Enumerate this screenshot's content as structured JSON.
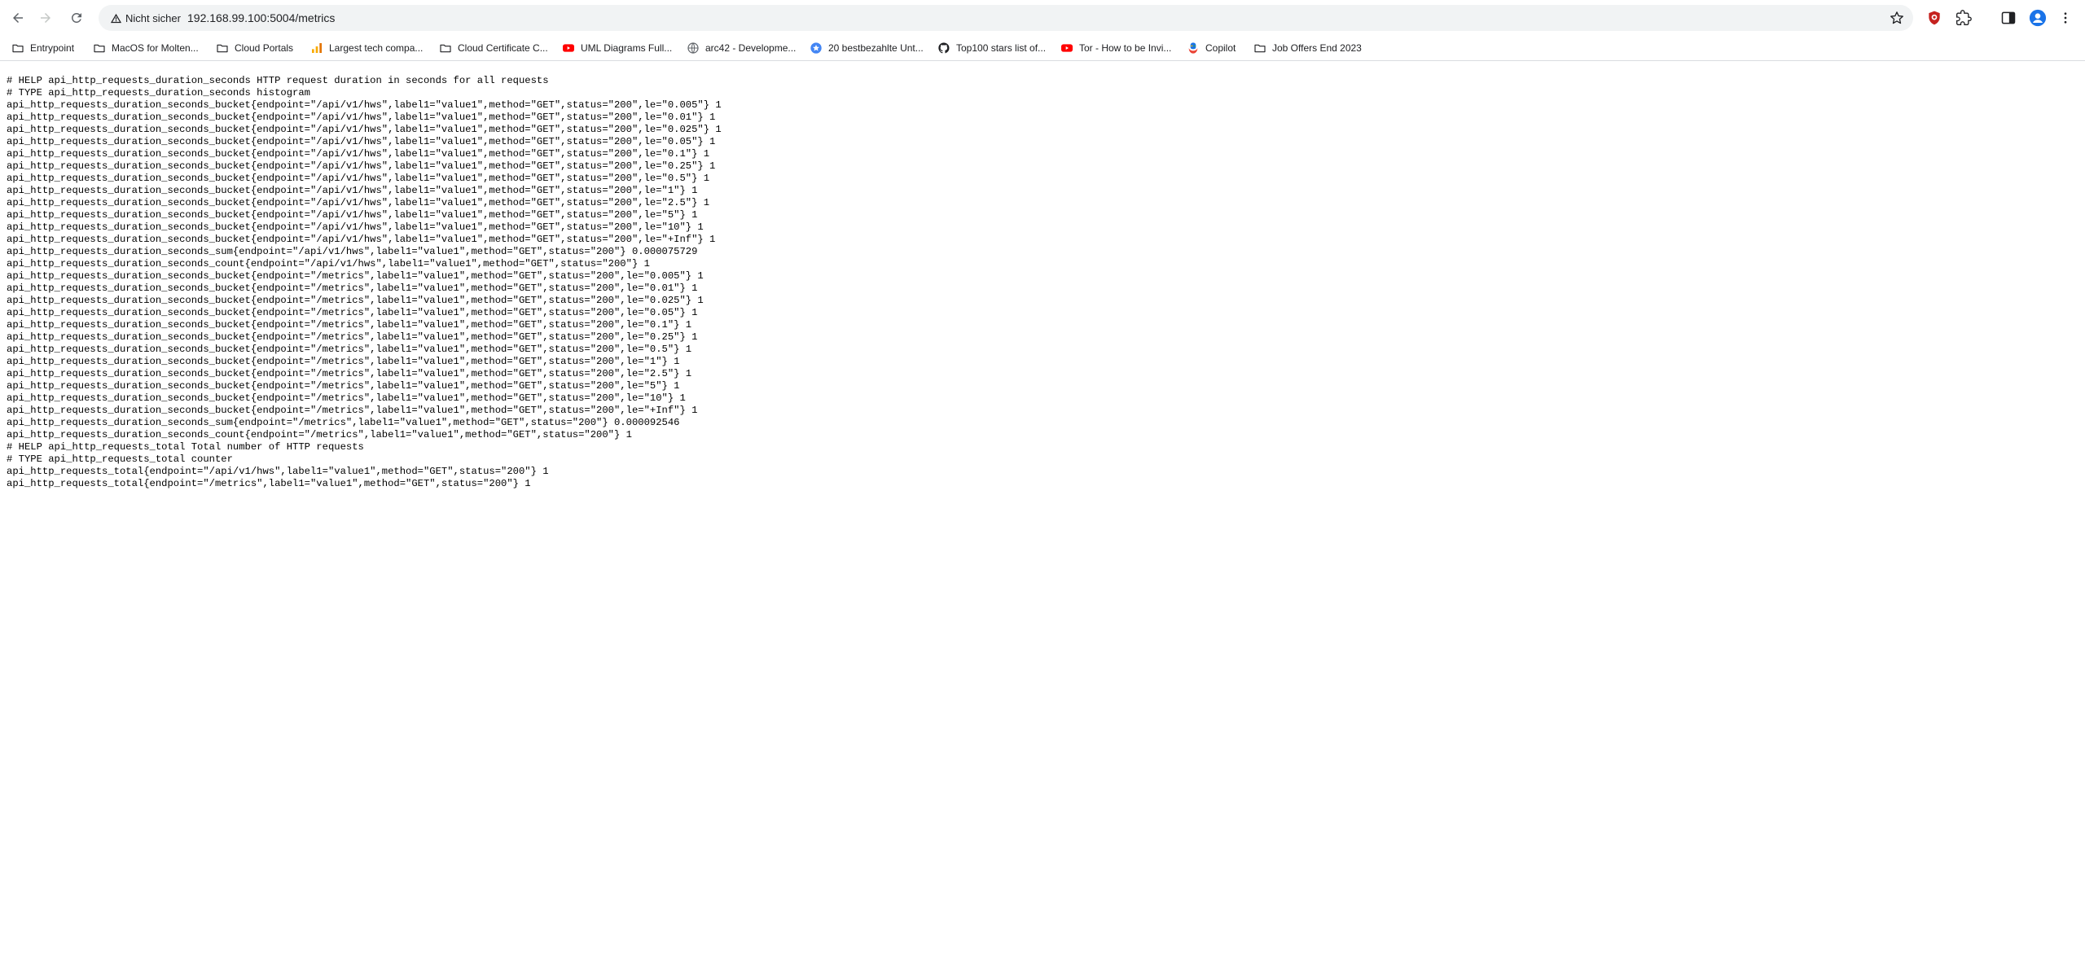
{
  "browser": {
    "security_label": "Nicht sicher",
    "url": "192.168.99.100:5004/metrics"
  },
  "bookmarks": [
    {
      "label": "Entrypoint",
      "icon": "folder-icon"
    },
    {
      "label": "MacOS for Molten...",
      "icon": "folder-icon"
    },
    {
      "label": "Cloud Portals",
      "icon": "folder-icon"
    },
    {
      "label": "Largest tech compa...",
      "icon": "bar-chart-icon"
    },
    {
      "label": "Cloud Certificate C...",
      "icon": "folder-icon"
    },
    {
      "label": "UML Diagrams Full...",
      "icon": "youtube-icon"
    },
    {
      "label": "arc42 - Developme...",
      "icon": "globe-icon"
    },
    {
      "label": "20 bestbezahlte Unt...",
      "icon": "star-badge-icon"
    },
    {
      "label": "Top100 stars list of...",
      "icon": "github-icon"
    },
    {
      "label": "Tor - How to be Invi...",
      "icon": "youtube-icon"
    },
    {
      "label": "Copilot",
      "icon": "copilot-icon"
    },
    {
      "label": "Job Offers End 2023",
      "icon": "folder-icon"
    }
  ],
  "metrics_lines": [
    "# HELP api_http_requests_duration_seconds HTTP request duration in seconds for all requests",
    "# TYPE api_http_requests_duration_seconds histogram",
    "api_http_requests_duration_seconds_bucket{endpoint=\"/api/v1/hws\",label1=\"value1\",method=\"GET\",status=\"200\",le=\"0.005\"} 1",
    "api_http_requests_duration_seconds_bucket{endpoint=\"/api/v1/hws\",label1=\"value1\",method=\"GET\",status=\"200\",le=\"0.01\"} 1",
    "api_http_requests_duration_seconds_bucket{endpoint=\"/api/v1/hws\",label1=\"value1\",method=\"GET\",status=\"200\",le=\"0.025\"} 1",
    "api_http_requests_duration_seconds_bucket{endpoint=\"/api/v1/hws\",label1=\"value1\",method=\"GET\",status=\"200\",le=\"0.05\"} 1",
    "api_http_requests_duration_seconds_bucket{endpoint=\"/api/v1/hws\",label1=\"value1\",method=\"GET\",status=\"200\",le=\"0.1\"} 1",
    "api_http_requests_duration_seconds_bucket{endpoint=\"/api/v1/hws\",label1=\"value1\",method=\"GET\",status=\"200\",le=\"0.25\"} 1",
    "api_http_requests_duration_seconds_bucket{endpoint=\"/api/v1/hws\",label1=\"value1\",method=\"GET\",status=\"200\",le=\"0.5\"} 1",
    "api_http_requests_duration_seconds_bucket{endpoint=\"/api/v1/hws\",label1=\"value1\",method=\"GET\",status=\"200\",le=\"1\"} 1",
    "api_http_requests_duration_seconds_bucket{endpoint=\"/api/v1/hws\",label1=\"value1\",method=\"GET\",status=\"200\",le=\"2.5\"} 1",
    "api_http_requests_duration_seconds_bucket{endpoint=\"/api/v1/hws\",label1=\"value1\",method=\"GET\",status=\"200\",le=\"5\"} 1",
    "api_http_requests_duration_seconds_bucket{endpoint=\"/api/v1/hws\",label1=\"value1\",method=\"GET\",status=\"200\",le=\"10\"} 1",
    "api_http_requests_duration_seconds_bucket{endpoint=\"/api/v1/hws\",label1=\"value1\",method=\"GET\",status=\"200\",le=\"+Inf\"} 1",
    "api_http_requests_duration_seconds_sum{endpoint=\"/api/v1/hws\",label1=\"value1\",method=\"GET\",status=\"200\"} 0.000075729",
    "api_http_requests_duration_seconds_count{endpoint=\"/api/v1/hws\",label1=\"value1\",method=\"GET\",status=\"200\"} 1",
    "api_http_requests_duration_seconds_bucket{endpoint=\"/metrics\",label1=\"value1\",method=\"GET\",status=\"200\",le=\"0.005\"} 1",
    "api_http_requests_duration_seconds_bucket{endpoint=\"/metrics\",label1=\"value1\",method=\"GET\",status=\"200\",le=\"0.01\"} 1",
    "api_http_requests_duration_seconds_bucket{endpoint=\"/metrics\",label1=\"value1\",method=\"GET\",status=\"200\",le=\"0.025\"} 1",
    "api_http_requests_duration_seconds_bucket{endpoint=\"/metrics\",label1=\"value1\",method=\"GET\",status=\"200\",le=\"0.05\"} 1",
    "api_http_requests_duration_seconds_bucket{endpoint=\"/metrics\",label1=\"value1\",method=\"GET\",status=\"200\",le=\"0.1\"} 1",
    "api_http_requests_duration_seconds_bucket{endpoint=\"/metrics\",label1=\"value1\",method=\"GET\",status=\"200\",le=\"0.25\"} 1",
    "api_http_requests_duration_seconds_bucket{endpoint=\"/metrics\",label1=\"value1\",method=\"GET\",status=\"200\",le=\"0.5\"} 1",
    "api_http_requests_duration_seconds_bucket{endpoint=\"/metrics\",label1=\"value1\",method=\"GET\",status=\"200\",le=\"1\"} 1",
    "api_http_requests_duration_seconds_bucket{endpoint=\"/metrics\",label1=\"value1\",method=\"GET\",status=\"200\",le=\"2.5\"} 1",
    "api_http_requests_duration_seconds_bucket{endpoint=\"/metrics\",label1=\"value1\",method=\"GET\",status=\"200\",le=\"5\"} 1",
    "api_http_requests_duration_seconds_bucket{endpoint=\"/metrics\",label1=\"value1\",method=\"GET\",status=\"200\",le=\"10\"} 1",
    "api_http_requests_duration_seconds_bucket{endpoint=\"/metrics\",label1=\"value1\",method=\"GET\",status=\"200\",le=\"+Inf\"} 1",
    "api_http_requests_duration_seconds_sum{endpoint=\"/metrics\",label1=\"value1\",method=\"GET\",status=\"200\"} 0.000092546",
    "api_http_requests_duration_seconds_count{endpoint=\"/metrics\",label1=\"value1\",method=\"GET\",status=\"200\"} 1",
    "# HELP api_http_requests_total Total number of HTTP requests",
    "# TYPE api_http_requests_total counter",
    "api_http_requests_total{endpoint=\"/api/v1/hws\",label1=\"value1\",method=\"GET\",status=\"200\"} 1",
    "api_http_requests_total{endpoint=\"/metrics\",label1=\"value1\",method=\"GET\",status=\"200\"} 1"
  ]
}
